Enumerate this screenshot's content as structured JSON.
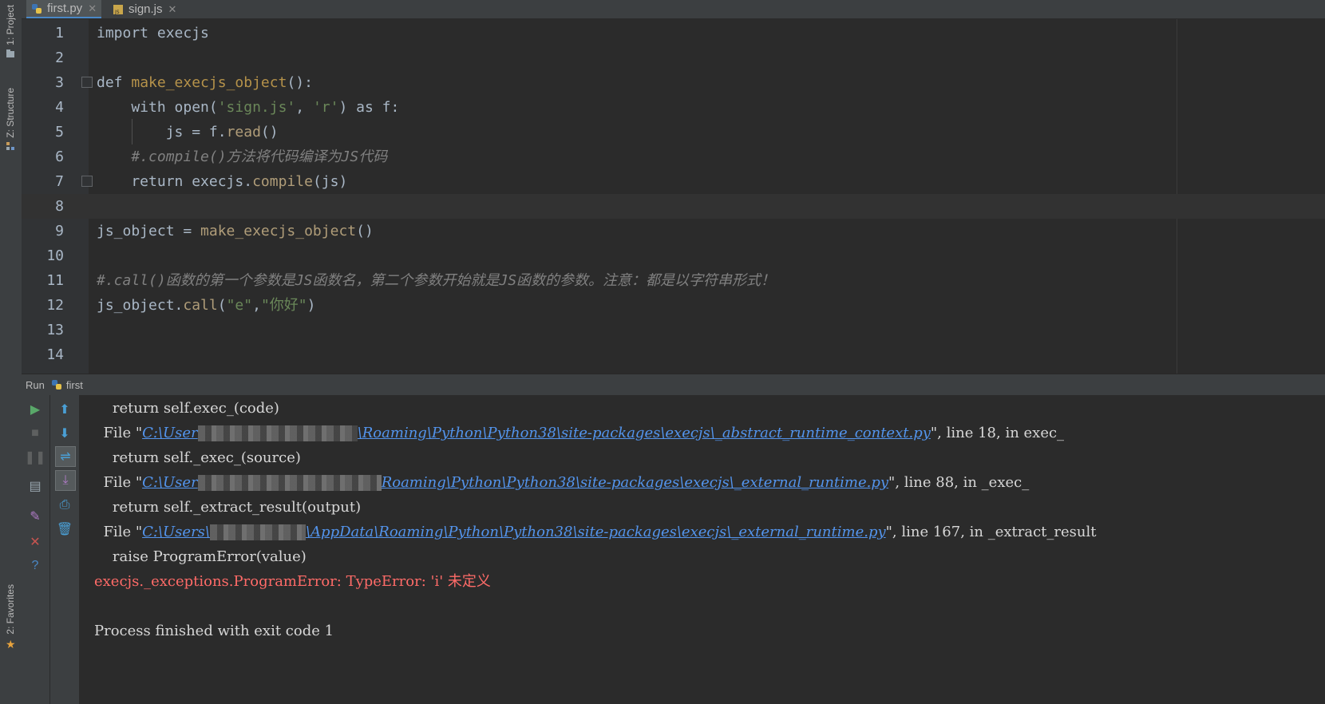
{
  "tabs": [
    {
      "label": "first.py",
      "active": true
    },
    {
      "label": "sign.js",
      "active": false
    }
  ],
  "tool_windows": {
    "project": "1: Project",
    "structure": "Z: Structure",
    "favorites": "2: Favorites"
  },
  "editor": {
    "current_line": 8,
    "lines": [
      {
        "num": "1",
        "tokens": [
          {
            "t": "import execjs",
            "c": "plain"
          }
        ]
      },
      {
        "num": "2",
        "tokens": []
      },
      {
        "num": "3",
        "tokens": [
          {
            "t": "def ",
            "c": "plain"
          },
          {
            "t": "make_execjs_object",
            "c": "def"
          },
          {
            "t": "():",
            "c": "plain"
          }
        ]
      },
      {
        "num": "4",
        "tokens": [
          {
            "t": "    with open(",
            "c": "plain"
          },
          {
            "t": "'sign.js'",
            "c": "str"
          },
          {
            "t": ", ",
            "c": "plain"
          },
          {
            "t": "'r'",
            "c": "str"
          },
          {
            "t": ") as f:",
            "c": "plain"
          }
        ]
      },
      {
        "num": "5",
        "tokens": [
          {
            "t": "        js = f.",
            "c": "plain"
          },
          {
            "t": "read",
            "c": "call"
          },
          {
            "t": "()",
            "c": "plain"
          }
        ]
      },
      {
        "num": "6",
        "tokens": [
          {
            "t": "    #.compile()方法将代码编译为JS代码",
            "c": "cmt"
          }
        ]
      },
      {
        "num": "7",
        "tokens": [
          {
            "t": "    return execjs.",
            "c": "plain"
          },
          {
            "t": "compile",
            "c": "call"
          },
          {
            "t": "(js)",
            "c": "plain"
          }
        ]
      },
      {
        "num": "8",
        "tokens": []
      },
      {
        "num": "9",
        "tokens": [
          {
            "t": "js_object = ",
            "c": "plain"
          },
          {
            "t": "make_execjs_object",
            "c": "call"
          },
          {
            "t": "()",
            "c": "plain"
          }
        ]
      },
      {
        "num": "10",
        "tokens": []
      },
      {
        "num": "11",
        "tokens": [
          {
            "t": "#.call()函数的第一个参数是JS函数名，第二个参数开始就是JS函数的参数。注意：都是以字符串形式！",
            "c": "cmt"
          }
        ]
      },
      {
        "num": "12",
        "tokens": [
          {
            "t": "js_object.",
            "c": "plain"
          },
          {
            "t": "call",
            "c": "call"
          },
          {
            "t": "(",
            "c": "plain"
          },
          {
            "t": "\"e\"",
            "c": "str"
          },
          {
            "t": ",",
            "c": "plain"
          },
          {
            "t": "\"你好\"",
            "c": "str"
          },
          {
            "t": ")",
            "c": "plain"
          }
        ]
      },
      {
        "num": "13",
        "tokens": []
      },
      {
        "num": "14",
        "tokens": []
      }
    ]
  },
  "run_panel": {
    "label": "Run",
    "config": "first",
    "console": [
      {
        "segs": [
          {
            "t": "    return self.exec_(code)",
            "c": "plain"
          }
        ]
      },
      {
        "segs": [
          {
            "t": "  File \"",
            "c": "plain"
          },
          {
            "t": "C:\\User",
            "c": "link"
          },
          {
            "t": "",
            "c": "blur",
            "w": 200
          },
          {
            "t": "\\Roaming\\Python\\Python38\\site-packages\\execjs\\_abstract_runtime_context.py",
            "c": "link"
          },
          {
            "t": "\", line 18, in exec_",
            "c": "plain"
          }
        ]
      },
      {
        "segs": [
          {
            "t": "    return self._exec_(source)",
            "c": "plain"
          }
        ]
      },
      {
        "segs": [
          {
            "t": "  File \"",
            "c": "plain"
          },
          {
            "t": "C:\\User",
            "c": "link"
          },
          {
            "t": "",
            "c": "blur",
            "w": 230
          },
          {
            "t": "Roaming\\Python\\Python38\\site-packages\\execjs\\_external_runtime.py",
            "c": "link"
          },
          {
            "t": "\", line 88, in _exec_",
            "c": "plain"
          }
        ]
      },
      {
        "segs": [
          {
            "t": "    return self._extract_result(output)",
            "c": "plain"
          }
        ]
      },
      {
        "segs": [
          {
            "t": "  File \"",
            "c": "plain"
          },
          {
            "t": "C:\\Users\\",
            "c": "link"
          },
          {
            "t": "",
            "c": "blur",
            "w": 120
          },
          {
            "t": "\\AppData\\Roaming\\Python\\Python38\\site-packages\\execjs\\_external_runtime.py",
            "c": "link"
          },
          {
            "t": "\", line 167, in _extract_result",
            "c": "plain"
          }
        ]
      },
      {
        "segs": [
          {
            "t": "    raise ProgramError(value)",
            "c": "plain"
          }
        ]
      },
      {
        "segs": [
          {
            "t": "execjs._exceptions.ProgramError: TypeError: 'i' 未定义",
            "c": "err"
          }
        ]
      },
      {
        "segs": []
      },
      {
        "segs": [
          {
            "t": "Process finished with exit code 1",
            "c": "plain"
          }
        ]
      }
    ]
  }
}
